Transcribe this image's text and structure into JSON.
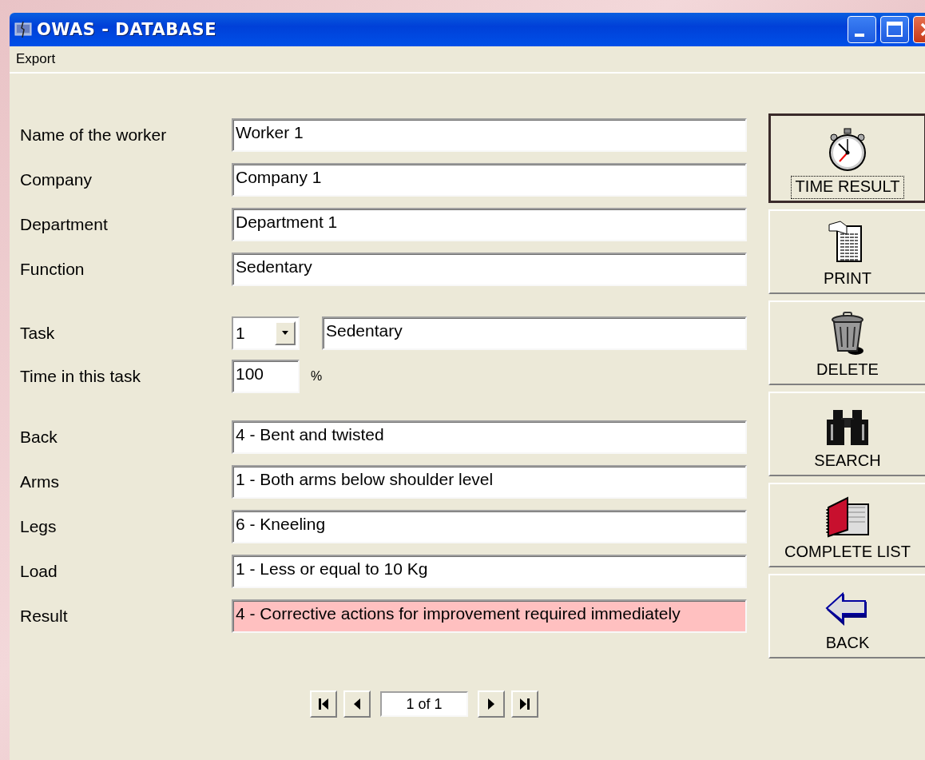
{
  "window": {
    "title": "OWAS - DATABASE"
  },
  "menu": [
    "Export"
  ],
  "worker_fields": [
    {
      "label": "Name of the worker",
      "value": "Worker 1"
    },
    {
      "label": "Company",
      "value": "Company 1"
    },
    {
      "label": "Department",
      "value": "Department 1"
    },
    {
      "label": "Function",
      "value": "Sedentary"
    }
  ],
  "task": {
    "label": "Task",
    "number": "1",
    "name": "Sedentary"
  },
  "time": {
    "label": "Time in this task",
    "value": "100",
    "unit": "%"
  },
  "posture_fields": [
    {
      "label": "Back",
      "value": "4 - Bent and twisted",
      "highlighted": false
    },
    {
      "label": "Arms",
      "value": "1 - Both arms below shoulder level",
      "highlighted": false
    },
    {
      "label": "Legs",
      "value": "6 - Kneeling",
      "highlighted": false
    },
    {
      "label": "Load",
      "value": "1 - Less or equal to 10 Kg",
      "highlighted": false
    },
    {
      "label": "Result",
      "value": "4 - Corrective actions for improvement required immediately",
      "highlighted": true
    }
  ],
  "pager": {
    "position": "1 of 1"
  },
  "buttons": [
    {
      "kind": "stopwatch",
      "label": "TIME RESULT",
      "focused": true
    },
    {
      "kind": "print",
      "label": "PRINT",
      "focused": false
    },
    {
      "kind": "trash",
      "label": "DELETE",
      "focused": false
    },
    {
      "kind": "binoculars",
      "label": "SEARCH",
      "focused": false
    },
    {
      "kind": "book",
      "label": "COMPLETE LIST",
      "focused": false
    },
    {
      "kind": "back",
      "label": "BACK",
      "focused": false
    }
  ]
}
